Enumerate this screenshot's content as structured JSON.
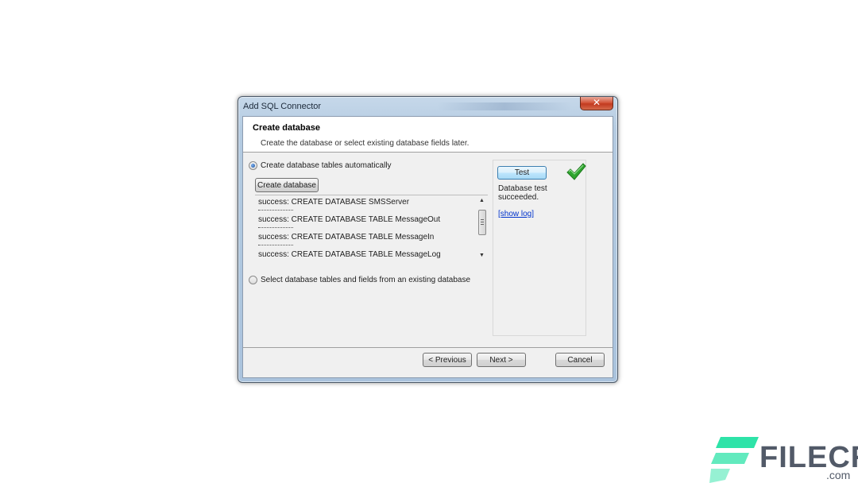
{
  "window": {
    "title": "Add SQL Connector",
    "close_glyph": "✕"
  },
  "header": {
    "title": "Create database",
    "subtitle": "Create the database or select existing database fields later."
  },
  "options": {
    "auto_label": "Create database tables automatically",
    "auto_checked": true,
    "existing_label": "Select database tables and fields from an existing database",
    "existing_checked": false
  },
  "create_button": {
    "label": "Create database"
  },
  "log": {
    "lines": [
      "success: CREATE DATABASE SMSServer",
      "success: CREATE DATABASE TABLE MessageOut",
      "success: CREATE DATABASE TABLE MessageIn",
      "success: CREATE DATABASE TABLE MessageLog"
    ],
    "scroll_up_glyph": "▲",
    "scroll_down_glyph": "▼"
  },
  "test_panel": {
    "button_label": "Test",
    "status": "Database test succeeded.",
    "link": "[show log]",
    "status_icon": "check-icon",
    "icon_color": "#2fa52f"
  },
  "footer": {
    "previous_label": "< Previous",
    "next_label": "Next >",
    "cancel_label": "Cancel"
  },
  "watermark": {
    "brand": "FILECR",
    "suffix": ".com",
    "accent_color": "#2ee3a8"
  }
}
